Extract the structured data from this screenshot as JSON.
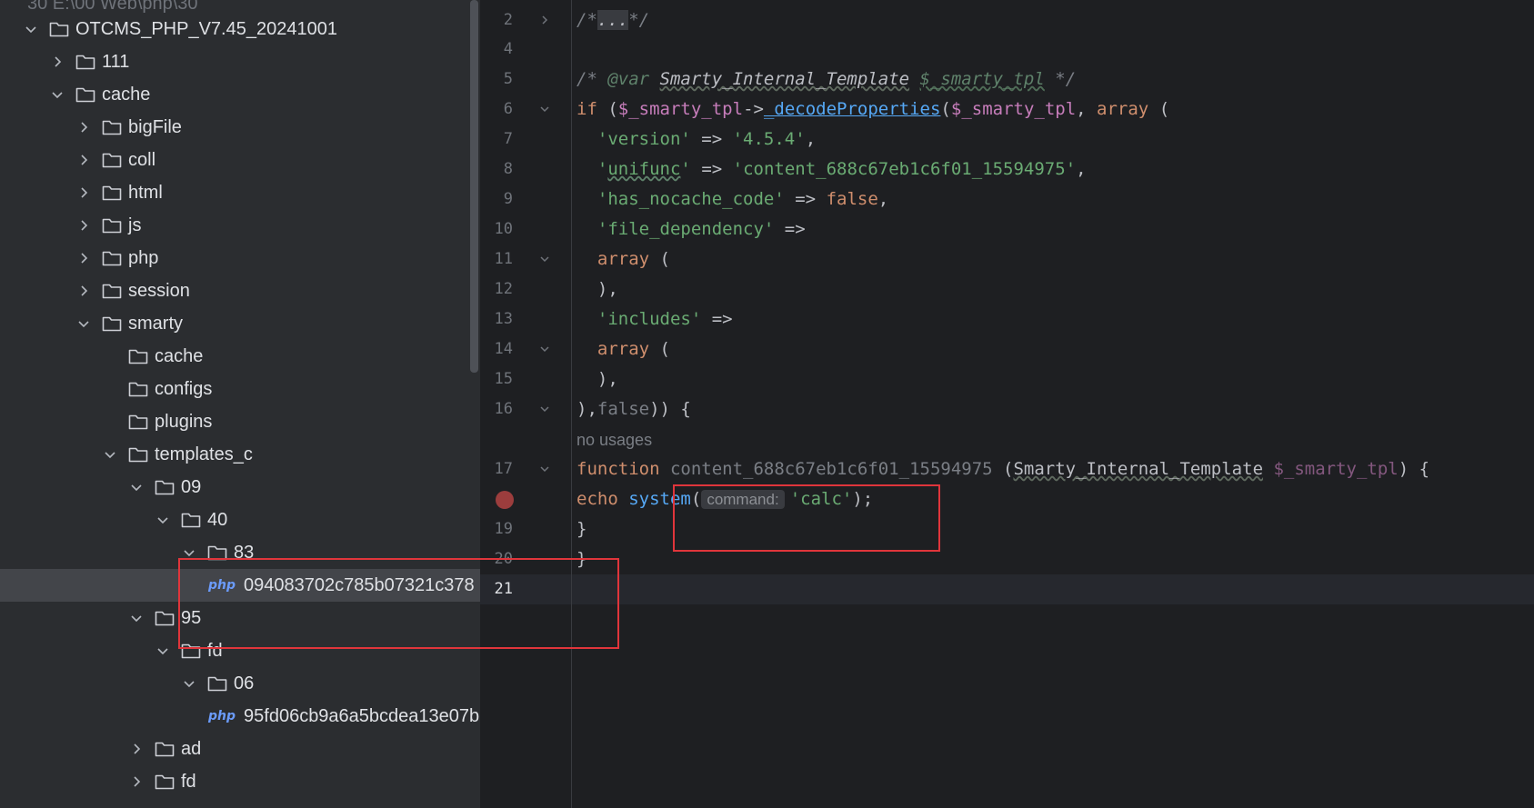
{
  "sidebar": {
    "header_partial": "30  E:\\00 Web\\php\\30",
    "items": [
      {
        "label": "OTCMS_PHP_V7.45_20241001",
        "chevron": "down",
        "type": "folder"
      },
      {
        "label": "111",
        "chevron": "right",
        "type": "folder"
      },
      {
        "label": "cache",
        "chevron": "down",
        "type": "folder"
      },
      {
        "label": "bigFile",
        "chevron": "right",
        "type": "folder"
      },
      {
        "label": "coll",
        "chevron": "right",
        "type": "folder"
      },
      {
        "label": "html",
        "chevron": "right",
        "type": "folder"
      },
      {
        "label": "js",
        "chevron": "right",
        "type": "folder"
      },
      {
        "label": "php",
        "chevron": "right",
        "type": "folder"
      },
      {
        "label": "session",
        "chevron": "right",
        "type": "folder"
      },
      {
        "label": "smarty",
        "chevron": "down",
        "type": "folder"
      },
      {
        "label": "cache",
        "chevron": "none",
        "type": "folder"
      },
      {
        "label": "configs",
        "chevron": "none",
        "type": "folder"
      },
      {
        "label": "plugins",
        "chevron": "none",
        "type": "folder"
      },
      {
        "label": "templates_c",
        "chevron": "down",
        "type": "folder"
      },
      {
        "label": "09",
        "chevron": "down",
        "type": "folder"
      },
      {
        "label": "40",
        "chevron": "down",
        "type": "folder"
      },
      {
        "label": "83",
        "chevron": "down",
        "type": "folder"
      },
      {
        "label": "094083702c785b07321c378",
        "chevron": "none",
        "type": "php",
        "badge": "php",
        "selected": true
      },
      {
        "label": "95",
        "chevron": "down",
        "type": "folder"
      },
      {
        "label": "fd",
        "chevron": "down",
        "type": "folder"
      },
      {
        "label": "06",
        "chevron": "down",
        "type": "folder"
      },
      {
        "label": "95fd06cb9a6a5bcdea13e07b",
        "chevron": "none",
        "type": "php",
        "badge": "php"
      },
      {
        "label": "ad",
        "chevron": "right",
        "type": "folder"
      },
      {
        "label": "fd",
        "chevron": "right",
        "type": "folder"
      }
    ]
  },
  "editor": {
    "line_numbers": [
      "2",
      "4",
      "5",
      "6",
      "7",
      "8",
      "9",
      "10",
      "11",
      "12",
      "13",
      "14",
      "15",
      "16",
      "17",
      "19",
      "20",
      "21"
    ],
    "active_line": "21",
    "no_usages_label": "no usages",
    "inlay_hint": "command:",
    "code": {
      "l2": {
        "open": "/*",
        "folded": "...",
        "close": "*/"
      },
      "l5": {
        "open": "/* ",
        "tag": "@var ",
        "type": "Smarty_Internal_Template",
        "space": " ",
        "var": "$_smarty_tpl",
        "close": " */"
      },
      "l6": {
        "kw_if": "if",
        "p1": " (",
        "var1": "$_smarty_tpl",
        "arrow": "->",
        "fn": "_decodeProperties",
        "p2": "(",
        "var2": "$_smarty_tpl",
        "comma": ", ",
        "kw_array": "array",
        "p3": " ("
      },
      "l7": {
        "indent": "  ",
        "key": "'version'",
        "op": " => ",
        "val": "'4.5.4'",
        "end": ","
      },
      "l8": {
        "indent": "  ",
        "key_q1": "'",
        "key_w": "unifunc",
        "key_q2": "'",
        "op": " => ",
        "val": "'content_688c67eb1c6f01_15594975'",
        "end": ","
      },
      "l9": {
        "indent": "  ",
        "key": "'has_nocache_code'",
        "op": " => ",
        "val": "false",
        "end": ","
      },
      "l10": {
        "indent": "  ",
        "key": "'file_dependency'",
        "op": " =>"
      },
      "l11": {
        "indent": "  ",
        "kw": "array",
        "rest": " ("
      },
      "l12": {
        "text": "  ),"
      },
      "l13": {
        "indent": "  ",
        "key": "'includes'",
        "op": " =>"
      },
      "l14": {
        "indent": "  ",
        "kw": "array",
        "rest": " ("
      },
      "l15": {
        "text": "  ),"
      },
      "l16": {
        "a": "),",
        "b": "false",
        "c": ")) {"
      },
      "l17": {
        "kw": "function",
        "sp": " ",
        "name": "content_688c67eb1c6f01_15594975",
        "p1": " (",
        "type": "Smarty_Internal_Template",
        "sp2": " ",
        "var": "$_smarty_tpl",
        "close": ") {"
      },
      "l18": {
        "kw": "echo",
        "sp": " ",
        "fn": "system",
        "p1": "(",
        "str": "'calc'",
        "end": ");"
      },
      "l19": {
        "text": "}"
      },
      "l20": {
        "text": "}"
      }
    }
  },
  "colors": {
    "annotation_box": "#e0353b",
    "sidebar_bg": "#2b2d30",
    "editor_bg": "#1e1f22",
    "keyword": "#cf8e6d",
    "string": "#6aab73",
    "variable": "#c77dbb",
    "function": "#56a8f5"
  }
}
